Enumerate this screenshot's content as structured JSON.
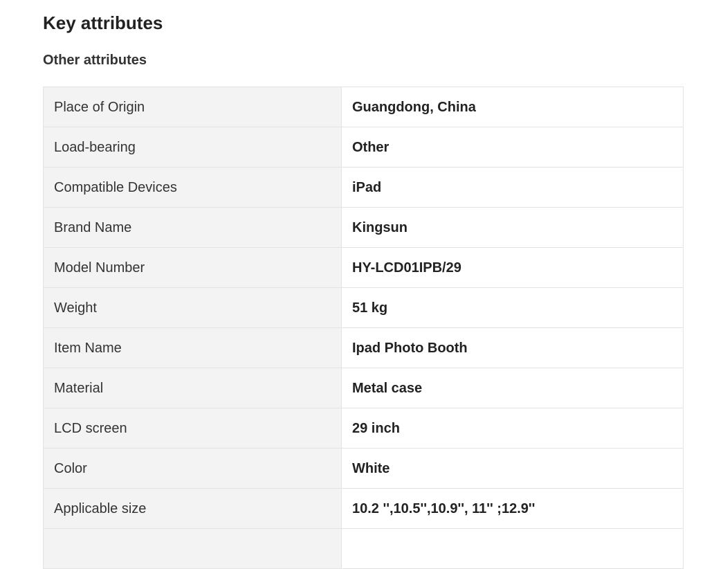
{
  "section": {
    "title": "Key attributes",
    "subtitle": "Other attributes"
  },
  "attributes": [
    {
      "key": "Place of Origin",
      "value": "Guangdong, China"
    },
    {
      "key": "Load-bearing",
      "value": "Other"
    },
    {
      "key": "Compatible Devices",
      "value": "iPad"
    },
    {
      "key": "Brand Name",
      "value": "Kingsun"
    },
    {
      "key": "Model Number",
      "value": "HY-LCD01IPB/29"
    },
    {
      "key": "Weight",
      "value": "51 kg"
    },
    {
      "key": "Item Name",
      "value": "Ipad Photo Booth"
    },
    {
      "key": "Material",
      "value": "Metal case"
    },
    {
      "key": "LCD screen",
      "value": "29 inch"
    },
    {
      "key": "Color",
      "value": "White"
    },
    {
      "key": "Applicable size",
      "value": "10.2 '',10.5'',10.9'', 11'' ;12.9''"
    },
    {
      "key": "",
      "value": ""
    }
  ]
}
